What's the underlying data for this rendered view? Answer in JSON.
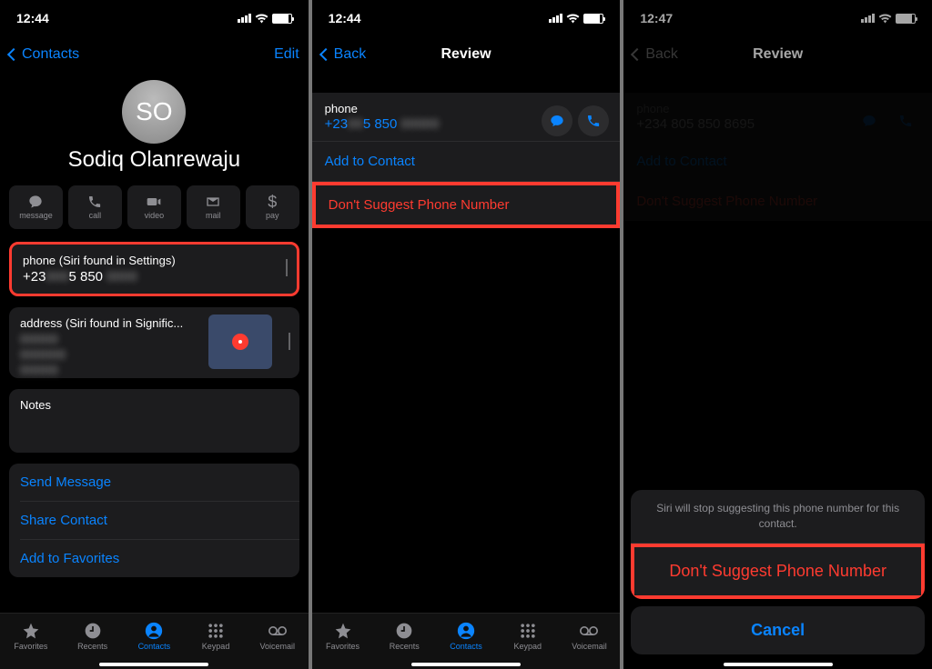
{
  "screen1": {
    "time": "12:44",
    "back_label": "Contacts",
    "edit_label": "Edit",
    "avatar_initials": "SO",
    "contact_name": "Sodiq Olanrewaju",
    "actions": {
      "message": "message",
      "call": "call",
      "video": "video",
      "mail": "mail",
      "pay": "pay"
    },
    "phone_card": {
      "label": "phone (Siri found in Settings)",
      "value_vis": "+23",
      "value_mid": "5 850",
      "blur1": "000",
      "blur2": "0000"
    },
    "address_card": {
      "label": "address (Siri found in Signific...",
      "blur1": "00000",
      "blur2": "000000",
      "blur3": "00000"
    },
    "notes_label": "Notes",
    "links": {
      "send": "Send Message",
      "share": "Share Contact",
      "fav": "Add to Favorites"
    },
    "tabs": {
      "fav": "Favorites",
      "rec": "Recents",
      "con": "Contacts",
      "key": "Keypad",
      "vm": "Voicemail"
    }
  },
  "screen2": {
    "time": "12:44",
    "back_label": "Back",
    "title": "Review",
    "phone_label": "phone",
    "phone_vis": "+23",
    "phone_mid": "5 850",
    "phone_blur1": "00",
    "phone_blur2": "00000",
    "add": "Add to Contact",
    "dont": "Don't Suggest Phone Number",
    "tabs": {
      "fav": "Favorites",
      "rec": "Recents",
      "con": "Contacts",
      "key": "Keypad",
      "vm": "Voicemail"
    }
  },
  "screen3": {
    "time": "12:47",
    "back_label": "Back",
    "title": "Review",
    "phone_label": "phone",
    "phone_value": "+234 805 850 8695",
    "add": "Add to Contact",
    "dont": "Don't Suggest Phone Number",
    "sheet_msg": "Siri will stop suggesting this phone number for this contact.",
    "sheet_dont": "Don't Suggest Phone Number",
    "sheet_cancel": "Cancel"
  }
}
